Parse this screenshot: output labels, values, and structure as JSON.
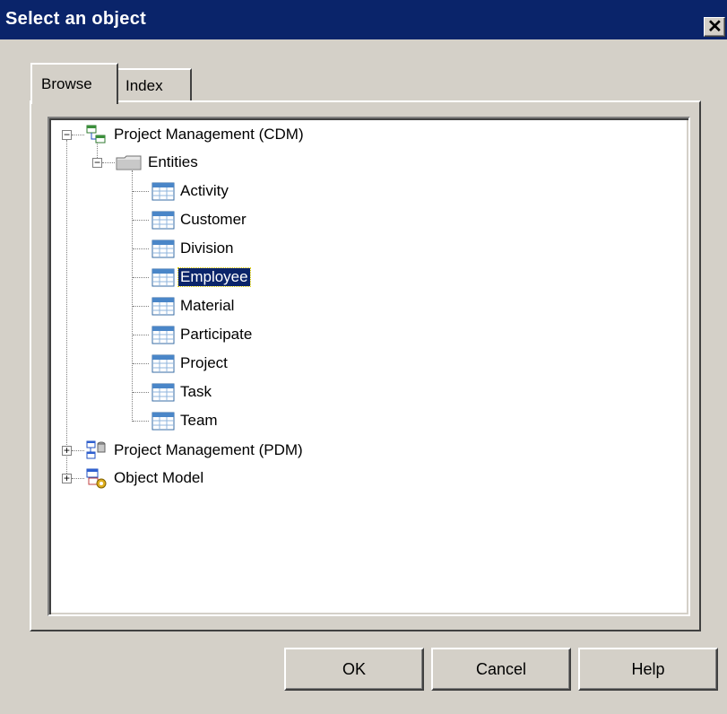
{
  "dialog": {
    "title": "Select an object",
    "close_glyph": "✕"
  },
  "tabs": [
    {
      "label": "Browse",
      "active": true
    },
    {
      "label": "Index",
      "active": false
    }
  ],
  "tree": {
    "nodes": [
      {
        "label": "Project Management (CDM)",
        "icon": "cdm-model-icon",
        "expanded": true
      },
      {
        "label": "Entities",
        "icon": "folder-icon",
        "expanded": true
      },
      {
        "label": "Activity",
        "icon": "entity-icon"
      },
      {
        "label": "Customer",
        "icon": "entity-icon"
      },
      {
        "label": "Division",
        "icon": "entity-icon"
      },
      {
        "label": "Employee",
        "icon": "entity-icon",
        "selected": true
      },
      {
        "label": "Material",
        "icon": "entity-icon"
      },
      {
        "label": "Participate",
        "icon": "entity-icon"
      },
      {
        "label": "Project",
        "icon": "entity-icon"
      },
      {
        "label": "Task",
        "icon": "entity-icon"
      },
      {
        "label": "Team",
        "icon": "entity-icon"
      },
      {
        "label": "Project Management (PDM)",
        "icon": "pdm-model-icon",
        "expanded": false
      },
      {
        "label": "Object Model",
        "icon": "oom-model-icon",
        "expanded": false
      }
    ]
  },
  "buttons": {
    "ok": "OK",
    "cancel": "Cancel",
    "help": "Help"
  },
  "colors": {
    "title_bar": "#0a246a",
    "selection": "#0a246a",
    "face": "#d4d0c8"
  }
}
